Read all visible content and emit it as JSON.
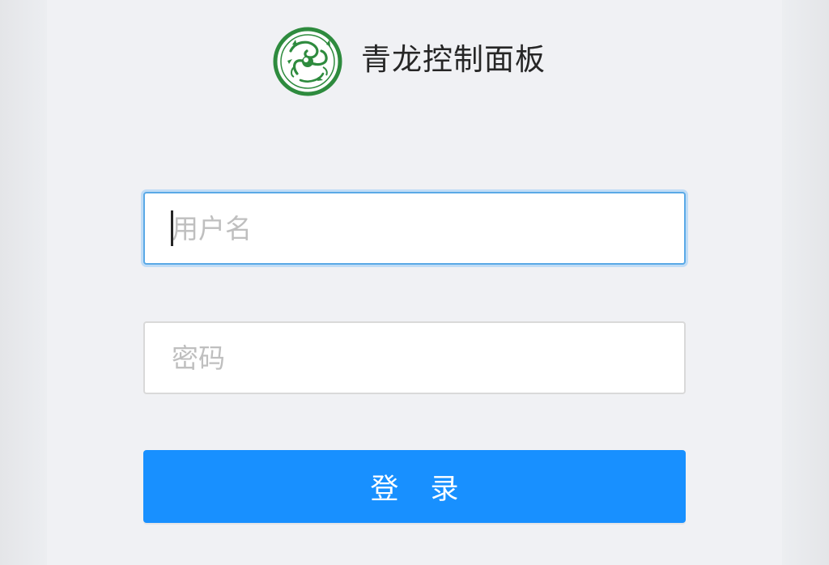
{
  "brand": {
    "title": "青龙控制面板",
    "logo_icon": "green-dragon-logo-icon",
    "logo_color": "#2e8b3e"
  },
  "login_form": {
    "username_placeholder": "用户名",
    "username_value": "",
    "password_placeholder": "密码",
    "password_value": "",
    "submit_label": "登 录"
  },
  "colors": {
    "primary": "#1890ff",
    "focus_border": "#5aa9e6",
    "background": "#f0f1f4"
  }
}
